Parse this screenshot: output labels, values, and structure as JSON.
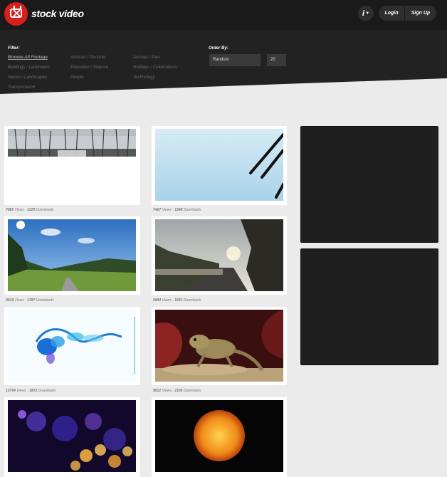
{
  "header": {
    "brand": "stock video",
    "info_label": "i",
    "login_label": "Login",
    "signup_label": "Sign Up"
  },
  "filter": {
    "title": "Filter:",
    "categories": [
      {
        "label": "Browse All Footage",
        "active": true
      },
      {
        "label": "Abstract / Textures"
      },
      {
        "label": "Animals / Pets"
      },
      {
        "label": "Buildings / Landmarks"
      },
      {
        "label": "Education / Science"
      },
      {
        "label": "Holidays / Celebrations"
      },
      {
        "label": "Nature / Landscapes"
      },
      {
        "label": "People"
      },
      {
        "label": "Technology"
      },
      {
        "label": "Transportation"
      }
    ]
  },
  "order": {
    "title": "Order By:",
    "selected": "Random",
    "per_page": "20"
  },
  "videos": [
    {
      "views": "7985",
      "downloads": "1129",
      "subject": "snowy forest"
    },
    {
      "views": "7467",
      "downloads": "1348",
      "subject": "cable sky"
    },
    {
      "views": "9018",
      "downloads": "1787",
      "subject": "countryside road"
    },
    {
      "views": "5984",
      "downloads": "1683",
      "subject": "cliff road sunset"
    },
    {
      "views": "10754",
      "downloads": "1803",
      "subject": "blue ink in water"
    },
    {
      "views": "9012",
      "downloads": "2169",
      "subject": "bearded dragon lizard"
    },
    {
      "views": "",
      "downloads": "",
      "subject": "bokeh lights"
    },
    {
      "views": "",
      "downloads": "",
      "subject": "sun"
    }
  ],
  "stats_text": {
    "views_suffix": " Views · ",
    "downloads_suffix": " Downloads"
  },
  "colors": {
    "brand_red": "#d7201e",
    "header_bg": "#1a1a1a",
    "page_bg": "#ebebeb"
  }
}
